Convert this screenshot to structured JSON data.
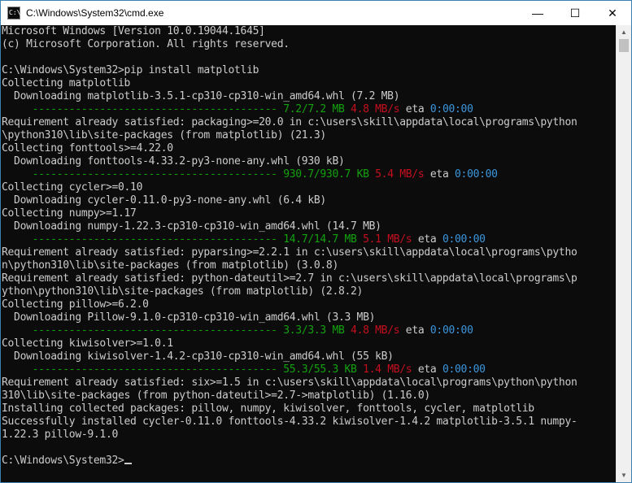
{
  "window": {
    "title": "C:\\Windows\\System32\\cmd.exe",
    "controls": {
      "minimize": "—",
      "maximize": "☐",
      "close": "✕"
    },
    "icon": "command-prompt-icon",
    "app_icon_text": "C:\\"
  },
  "console": {
    "lines": [
      [
        {
          "t": "Microsoft Windows [Version 10.0.19044.1645]"
        }
      ],
      [
        {
          "t": "(c) Microsoft Corporation. All rights reserved."
        }
      ],
      [
        {
          "t": ""
        }
      ],
      [
        {
          "t": "C:\\Windows\\System32>pip install matplotlib"
        }
      ],
      [
        {
          "t": "Collecting matplotlib"
        }
      ],
      [
        {
          "t": "  Downloading matplotlib-3.5.1-cp310-cp310-win_amd64.whl (7.2 MB)"
        }
      ],
      [
        {
          "t": "     ",
          "c": "white"
        },
        {
          "t": "----------------------------------------",
          "c": "green"
        },
        {
          "t": " 7.2/7.2 MB",
          "c": "green"
        },
        {
          "t": " 4.8 MB/s",
          "c": "red"
        },
        {
          "t": " eta ",
          "c": "white"
        },
        {
          "t": "0:00:00",
          "c": "cyan"
        }
      ],
      [
        {
          "t": "Requirement already satisfied: packaging>=20.0 in c:\\users\\skill\\appdata\\local\\programs\\python"
        }
      ],
      [
        {
          "t": "\\python310\\lib\\site-packages (from matplotlib) (21.3)"
        }
      ],
      [
        {
          "t": "Collecting fonttools>=4.22.0"
        }
      ],
      [
        {
          "t": "  Downloading fonttools-4.33.2-py3-none-any.whl (930 kB)"
        }
      ],
      [
        {
          "t": "     ",
          "c": "white"
        },
        {
          "t": "----------------------------------------",
          "c": "green"
        },
        {
          "t": " 930.7/930.7 KB",
          "c": "green"
        },
        {
          "t": " 5.4 MB/s",
          "c": "red"
        },
        {
          "t": " eta ",
          "c": "white"
        },
        {
          "t": "0:00:00",
          "c": "cyan"
        }
      ],
      [
        {
          "t": "Collecting cycler>=0.10"
        }
      ],
      [
        {
          "t": "  Downloading cycler-0.11.0-py3-none-any.whl (6.4 kB)"
        }
      ],
      [
        {
          "t": "Collecting numpy>=1.17"
        }
      ],
      [
        {
          "t": "  Downloading numpy-1.22.3-cp310-cp310-win_amd64.whl (14.7 MB)"
        }
      ],
      [
        {
          "t": "     ",
          "c": "white"
        },
        {
          "t": "----------------------------------------",
          "c": "green"
        },
        {
          "t": " 14.7/14.7 MB",
          "c": "green"
        },
        {
          "t": " 5.1 MB/s",
          "c": "red"
        },
        {
          "t": " eta ",
          "c": "white"
        },
        {
          "t": "0:00:00",
          "c": "cyan"
        }
      ],
      [
        {
          "t": "Requirement already satisfied: pyparsing>=2.2.1 in c:\\users\\skill\\appdata\\local\\programs\\pytho"
        }
      ],
      [
        {
          "t": "n\\python310\\lib\\site-packages (from matplotlib) (3.0.8)"
        }
      ],
      [
        {
          "t": "Requirement already satisfied: python-dateutil>=2.7 in c:\\users\\skill\\appdata\\local\\programs\\p"
        }
      ],
      [
        {
          "t": "ython\\python310\\lib\\site-packages (from matplotlib) (2.8.2)"
        }
      ],
      [
        {
          "t": "Collecting pillow>=6.2.0"
        }
      ],
      [
        {
          "t": "  Downloading Pillow-9.1.0-cp310-cp310-win_amd64.whl (3.3 MB)"
        }
      ],
      [
        {
          "t": "     ",
          "c": "white"
        },
        {
          "t": "----------------------------------------",
          "c": "green"
        },
        {
          "t": " 3.3/3.3 MB",
          "c": "green"
        },
        {
          "t": " 4.8 MB/s",
          "c": "red"
        },
        {
          "t": " eta ",
          "c": "white"
        },
        {
          "t": "0:00:00",
          "c": "cyan"
        }
      ],
      [
        {
          "t": "Collecting kiwisolver>=1.0.1"
        }
      ],
      [
        {
          "t": "  Downloading kiwisolver-1.4.2-cp310-cp310-win_amd64.whl (55 kB)"
        }
      ],
      [
        {
          "t": "     ",
          "c": "white"
        },
        {
          "t": "----------------------------------------",
          "c": "green"
        },
        {
          "t": " 55.3/55.3 KB",
          "c": "green"
        },
        {
          "t": " 1.4 MB/s",
          "c": "red"
        },
        {
          "t": " eta ",
          "c": "white"
        },
        {
          "t": "0:00:00",
          "c": "cyan"
        }
      ],
      [
        {
          "t": "Requirement already satisfied: six>=1.5 in c:\\users\\skill\\appdata\\local\\programs\\python\\python"
        }
      ],
      [
        {
          "t": "310\\lib\\site-packages (from python-dateutil>=2.7->matplotlib) (1.16.0)"
        }
      ],
      [
        {
          "t": "Installing collected packages: pillow, numpy, kiwisolver, fonttools, cycler, matplotlib"
        }
      ],
      [
        {
          "t": "Successfully installed cycler-0.11.0 fonttools-4.33.2 kiwisolver-1.4.2 matplotlib-3.5.1 numpy-"
        }
      ],
      [
        {
          "t": "1.22.3 pillow-9.1.0"
        }
      ],
      [
        {
          "t": ""
        }
      ],
      [
        {
          "t": "C:\\Windows\\System32>",
          "cursor": true
        }
      ]
    ]
  },
  "scrollbar": {
    "up_arrow": "▲",
    "down_arrow": "▼"
  },
  "colors": {
    "background": "#0c0c0c",
    "text": "#cccccc",
    "progress_green": "#13a10e",
    "speed_red": "#c50f1f",
    "eta_cyan": "#3a96dd"
  }
}
